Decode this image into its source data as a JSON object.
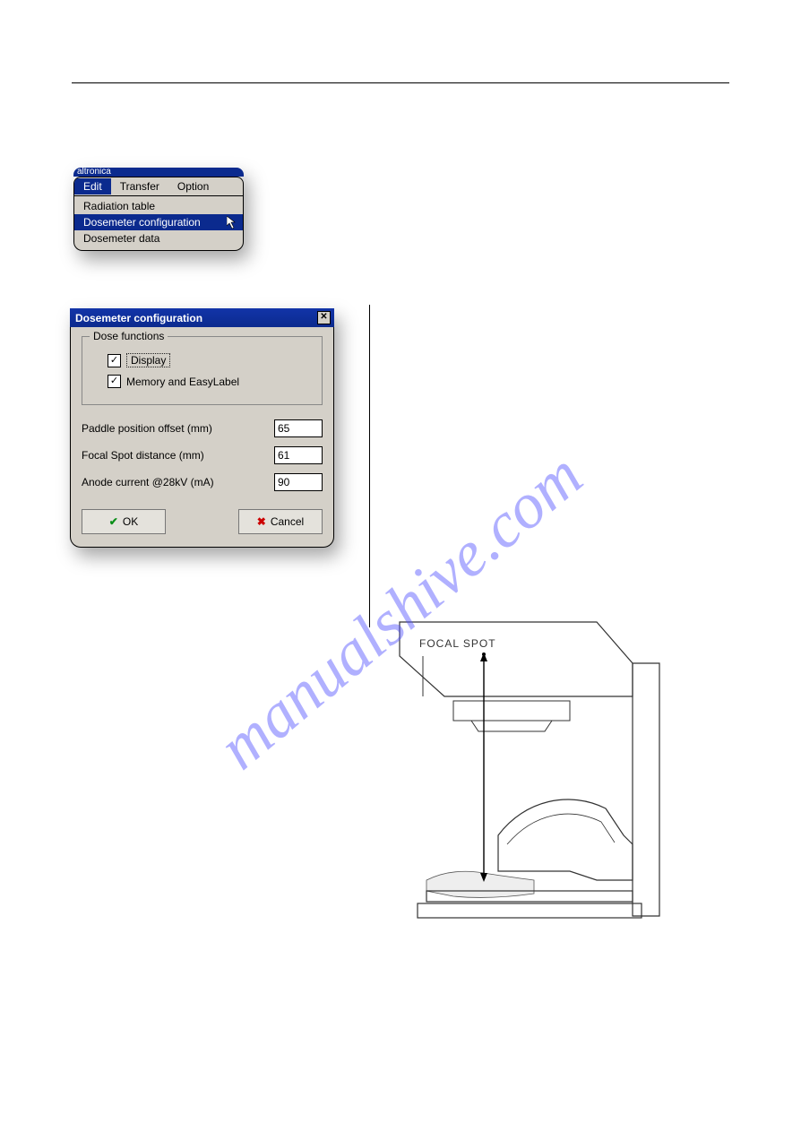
{
  "menu": {
    "title_fragment": "altronica",
    "items": [
      "Edit",
      "Transfer",
      "Option"
    ],
    "selected": "Edit",
    "dropdown": [
      {
        "label": "Radiation table",
        "selected": false
      },
      {
        "label": "Dosemeter configuration",
        "selected": true
      },
      {
        "label": "Dosemeter data",
        "selected": false
      }
    ]
  },
  "dialog": {
    "title": "Dosemeter configuration",
    "group_label": "Dose functions",
    "checkboxes": {
      "display": {
        "label": "Display",
        "checked": true
      },
      "memory": {
        "label": "Memory and EasyLabel",
        "checked": true
      }
    },
    "fields": {
      "paddle": {
        "label": "Paddle position offset (mm)",
        "value": "65"
      },
      "focal": {
        "label": "Focal Spot distance (mm)",
        "value": "61"
      },
      "anode": {
        "label": "Anode current @28kV (mA)",
        "value": "90"
      }
    },
    "buttons": {
      "ok": "OK",
      "cancel": "Cancel"
    }
  },
  "diagram": {
    "label": "FOCAL  SPOT"
  },
  "watermark": "manualshive.com"
}
